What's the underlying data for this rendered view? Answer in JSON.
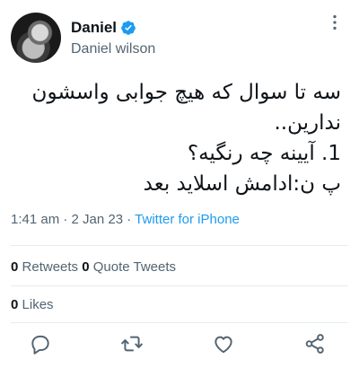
{
  "author": {
    "display_name": "Daniel",
    "handle": "Daniel wilson",
    "verified": true
  },
  "tweet": {
    "lines": [
      "سه تا سوال که هیچ جوابی واسشون",
      "ندارین..",
      "1.  آیینه چه رنگیه؟",
      "پ ن:ادامش اسلاید بعد"
    ]
  },
  "meta": {
    "time": "1:41 am",
    "separator": " · ",
    "date": "2 Jan 23",
    "source": "Twitter for iPhone"
  },
  "stats": {
    "retweets_count": "0",
    "retweets_label": "Retweets",
    "quotes_count": "0",
    "quotes_label": "Quote Tweets",
    "likes_count": "0",
    "likes_label": "Likes"
  },
  "colors": {
    "accent": "#1d9bf0",
    "secondary_text": "#536471",
    "divider": "#e6ecf0"
  },
  "icons": [
    "more-icon",
    "verified-badge-icon",
    "reply-icon",
    "retweet-icon",
    "like-icon",
    "share-icon"
  ]
}
